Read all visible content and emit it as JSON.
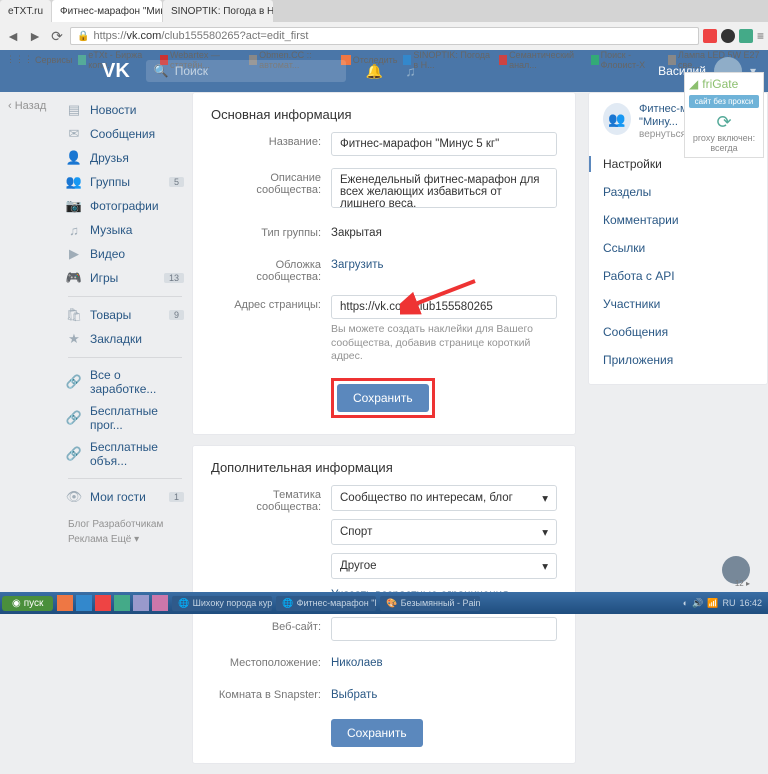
{
  "browser": {
    "tabs": [
      {
        "label": "eTXT.ru"
      },
      {
        "label": "Фитнес-марафон \"Мин..."
      },
      {
        "label": "SINOPTIK: Погода в Никол..."
      }
    ],
    "url_prefix": "https://",
    "url_host": "vk.com",
    "url_path": "/club155580265?act=edit_first",
    "bookmarks": [
      "Сервисы",
      "eTXt - Биржа копи...",
      "Webartex — статейн...",
      "Obmen.CC :: автомат...",
      "Отследить",
      "SINOPTIK: Погода в Н...",
      "Семантический анал...",
      "Поиск - Флорист-X",
      "Лампа LED 5W E27 све..."
    ]
  },
  "vk": {
    "search_placeholder": "Поиск",
    "username": "Василий"
  },
  "back_link": "Назад",
  "sidebar": {
    "items": [
      "Новости",
      "Сообщения",
      "Друзья",
      "Группы",
      "Фотографии",
      "Музыка",
      "Видео",
      "Игры",
      "Товары",
      "Закладки"
    ],
    "badges": {
      "3": "5",
      "7": "13",
      "8": "9"
    },
    "extra": [
      "Все о заработке...",
      "Бесплатные прог...",
      "Бесплатные объя..."
    ],
    "guests": "Мои гости",
    "guests_badge": "1",
    "footer": [
      "Блог",
      "Разработчикам",
      "Реклама",
      "Ещё"
    ]
  },
  "section1": {
    "title": "Основная информация",
    "rows": {
      "name_label": "Название:",
      "name_value": "Фитнес-марафон \"Минус 5 кг\"",
      "desc_label": "Описание сообщества:",
      "desc_value": "Еженедельный фитнес-марафон для всех желающих избавиться от лишнего веса.",
      "type_label": "Тип группы:",
      "type_value": "Закрытая",
      "cover_label": "Обложка сообщества:",
      "cover_value": "Загрузить",
      "addr_label": "Адрес страницы:",
      "addr_value": "https://vk.com/club155580265",
      "addr_help": "Вы можете создать наклейки для Вашего сообщества, добавив странице короткий адрес."
    },
    "save": "Сохранить"
  },
  "section2": {
    "title": "Дополнительная информация",
    "rows": {
      "topic_label": "Тематика сообщества:",
      "topic_value": "Сообщество по интересам, блог",
      "topic2_value": "Спорт",
      "topic3_value": "Другое",
      "age_link": "Указать возрастные ограничения",
      "web_label": "Веб-сайт:",
      "web_value": "",
      "loc_label": "Местоположение:",
      "loc_value": "Николаев",
      "room_label": "Комната в Snapster:",
      "room_value": "Выбрать"
    },
    "save": "Сохранить"
  },
  "right": {
    "club_name": "Фитнес-марафон \"Мину...",
    "club_back": "вернуться к странице",
    "items": [
      "Настройки",
      "Разделы",
      "Комментарии",
      "Ссылки",
      "Работа с API",
      "Участники",
      "Сообщения",
      "Приложения"
    ]
  },
  "frigate": {
    "name": "friGate",
    "btn": "сайт без прокси",
    "status": "proxy включен: всегда"
  },
  "taskbar": {
    "start": "пуск",
    "tasks": [
      "Шихоку порода кур...",
      "Фитнес-марафон \"М...",
      "Безымянный - Paint"
    ],
    "lang": "RU",
    "time": "16:42"
  },
  "avatar_count": "12"
}
